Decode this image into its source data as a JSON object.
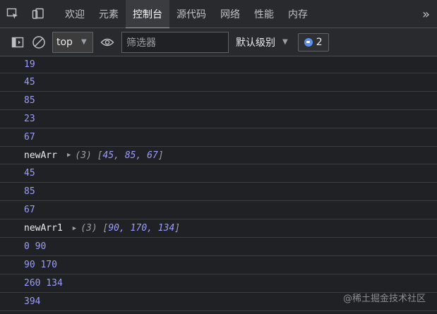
{
  "tabbar": {
    "tabs": [
      {
        "label": "欢迎"
      },
      {
        "label": "元素"
      },
      {
        "label": "控制台"
      },
      {
        "label": "源代码"
      },
      {
        "label": "网络"
      },
      {
        "label": "性能"
      },
      {
        "label": "内存"
      }
    ],
    "active_tab": "控制台",
    "more_label": "»"
  },
  "toolbar": {
    "context": "top",
    "filter_placeholder": "筛选器",
    "levels_label": "默认级别",
    "issues_count": "2"
  },
  "console": {
    "lines": [
      {
        "text": "19"
      },
      {
        "text": "45"
      },
      {
        "text": "85"
      },
      {
        "text": "23"
      },
      {
        "text": "67"
      },
      {
        "label": "newArr",
        "preview": "(3) [",
        "values": "45, 85, 67",
        "close": "]"
      },
      {
        "text": "45"
      },
      {
        "text": "85"
      },
      {
        "text": "67"
      },
      {
        "label": "newArr1",
        "preview": "(3) [",
        "values": "90, 170, 134",
        "close": "]"
      },
      {
        "text": "0 90"
      },
      {
        "text": "90 170"
      },
      {
        "text": "260 134"
      },
      {
        "text": "394"
      }
    ]
  },
  "watermark": "@稀土掘金技术社区"
}
